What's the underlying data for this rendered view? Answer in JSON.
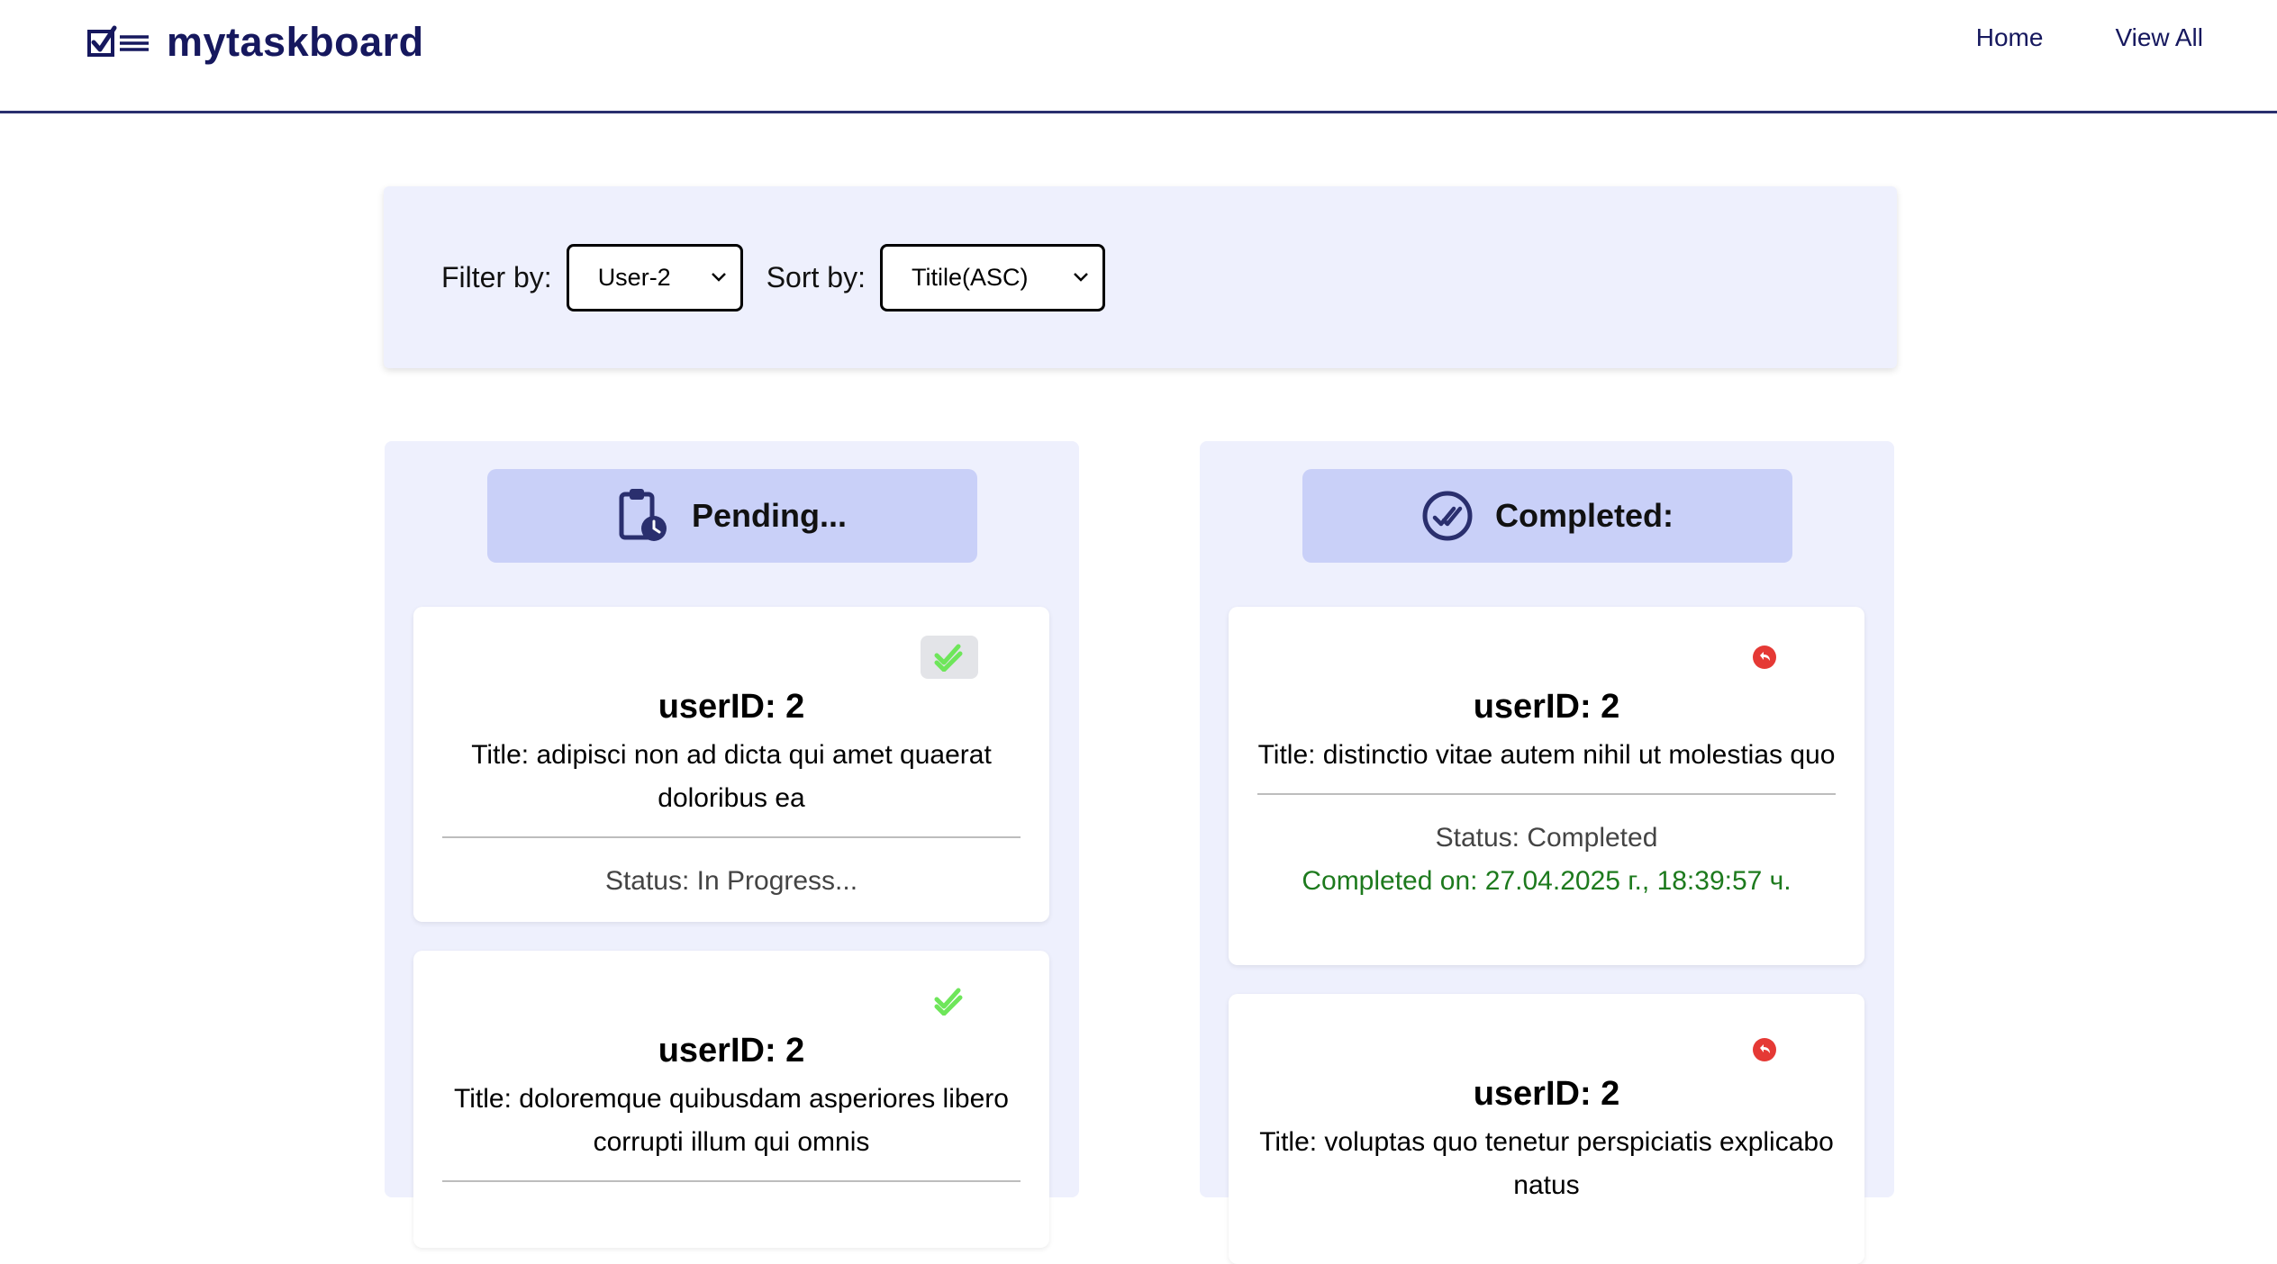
{
  "header": {
    "logo_text": "mytaskboard",
    "nav": [
      "Home",
      "View All"
    ]
  },
  "filters": {
    "filter_label": "Filter by:",
    "filter_value": "User-2",
    "sort_label": "Sort by:",
    "sort_value": "Titile(ASC)"
  },
  "columns": {
    "pending": {
      "title": "Pending...",
      "cards": [
        {
          "user": "userID: 2",
          "title": "Title: adipisci non ad dicta qui amet quaerat doloribus ea",
          "status": "Status: In Progress..."
        },
        {
          "user": "userID: 2",
          "title": "Title: doloremque quibusdam asperiores libero corrupti illum qui omnis"
        }
      ]
    },
    "completed": {
      "title": "Completed:",
      "cards": [
        {
          "user": "userID: 2",
          "title": "Title: distinctio vitae autem nihil ut molestias quo",
          "status": "Status: Completed",
          "completed_on": "Completed on: 27.04.2025 г., 18:39:57 ч."
        },
        {
          "user": "userID: 2",
          "title": "Title: voluptas quo tenetur perspiciatis explicabo natus"
        }
      ]
    }
  },
  "colors": {
    "brand": "#16185e",
    "panel_bg": "#eef0fd",
    "column_header_bg": "#c9d0f8",
    "complete_check": "#6ee65a",
    "undo_red": "#e53935",
    "completed_text": "#1d7a1d"
  },
  "icons": {
    "logo": "checklist-icon",
    "pending": "clipboard-clock-icon",
    "completed": "double-check-circle-icon",
    "mark_complete": "double-check-icon",
    "undo": "undo-arrow-icon"
  }
}
